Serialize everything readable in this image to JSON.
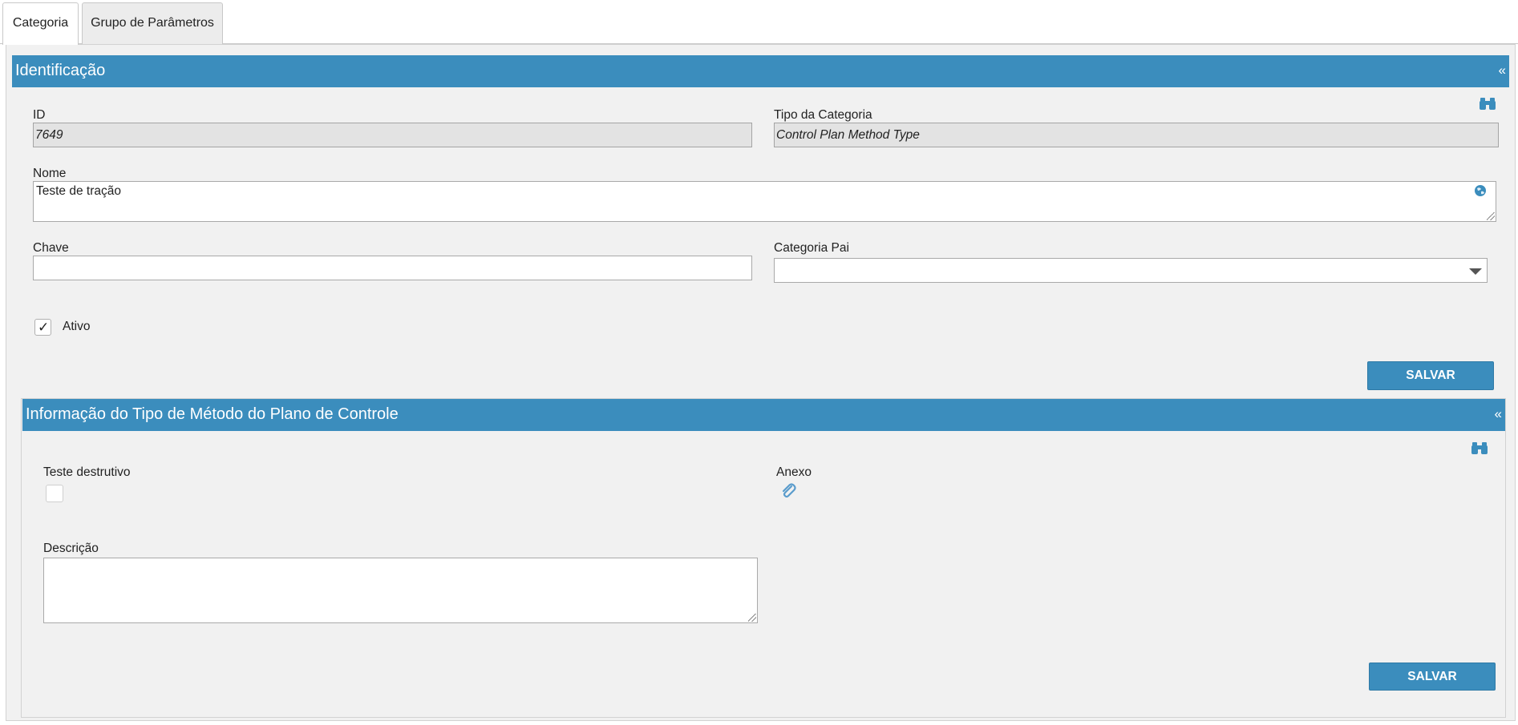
{
  "tabs": [
    {
      "label": "Categoria",
      "active": true
    },
    {
      "label": "Grupo de Parâmetros",
      "active": false
    }
  ],
  "identificacao": {
    "title": "Identificação",
    "collapse_icon": "«",
    "search_icon": "binoculars-icon",
    "id_label": "ID",
    "id_value": "7649",
    "tipo_label": "Tipo da Categoria",
    "tipo_value": "Control Plan Method Type",
    "nome_label": "Nome",
    "nome_value": "Teste de tração",
    "globe_icon": "globe-icon",
    "chave_label": "Chave",
    "chave_value": "",
    "categoria_pai_label": "Categoria Pai",
    "categoria_pai_value": "",
    "ativo_label": "Ativo",
    "ativo_checked": true,
    "save_label": "SALVAR"
  },
  "informacao": {
    "title": "Informação do Tipo de Método do Plano de Controle",
    "collapse_icon": "«",
    "search_icon": "binoculars-icon",
    "teste_destrutivo_label": "Teste destrutivo",
    "teste_destrutivo_checked": false,
    "anexo_label": "Anexo",
    "anexo_icon": "paperclip-icon",
    "descricao_label": "Descrição",
    "descricao_value": "",
    "save_label": "SALVAR"
  },
  "colors": {
    "accent": "#3b8dbd",
    "panel_bg": "#f1f1f1",
    "readonly_bg": "#e3e3e3"
  }
}
